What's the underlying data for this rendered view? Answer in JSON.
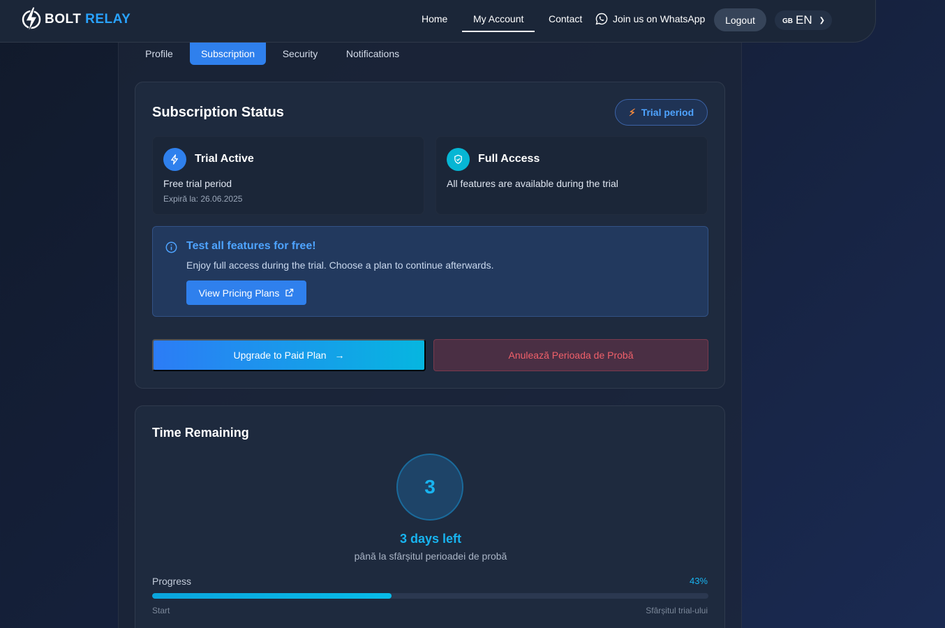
{
  "brand": {
    "name_part1": "BOLT",
    "name_part2": "RELAY"
  },
  "nav": {
    "home": "Home",
    "my_account": "My Account",
    "contact": "Contact",
    "whatsapp": "Join us on WhatsApp",
    "logout": "Logout",
    "lang_flag": "GB",
    "lang_code": "EN"
  },
  "tabs": [
    {
      "label": "Profile"
    },
    {
      "label": "Subscription",
      "active": true
    },
    {
      "label": "Security"
    },
    {
      "label": "Notifications"
    }
  ],
  "status_card": {
    "title": "Subscription Status",
    "badge": "Trial period",
    "trial_box": {
      "title": "Trial Active",
      "desc": "Free trial period",
      "expires": "Expiră la: 26.06.2025",
      "icon": "lightning-icon"
    },
    "access_box": {
      "title": "Full Access",
      "desc": "All features are available during the trial",
      "icon": "shield-check-icon"
    },
    "promo": {
      "title": "Test all features for free!",
      "desc": "Enjoy full access during the trial. Choose a plan to continue afterwards.",
      "button": "View Pricing Plans"
    },
    "upgrade_button": "Upgrade to Paid Plan",
    "cancel_button": "Anulează Perioada de Probă"
  },
  "time_card": {
    "title": "Time Remaining",
    "days_number": "3",
    "days_left": "3 days left",
    "days_sub": "până la sfârșitul perioadei de probă",
    "progress_label": "Progress",
    "progress_pct": "43%",
    "progress_value": 0.43,
    "start_label": "Start",
    "end_label": "Sfârșitul trial-ului"
  },
  "colors": {
    "accent": "#2f80ed",
    "cyan": "#18b4f0",
    "danger": "#f0606a",
    "orange": "#ff8a3d"
  }
}
